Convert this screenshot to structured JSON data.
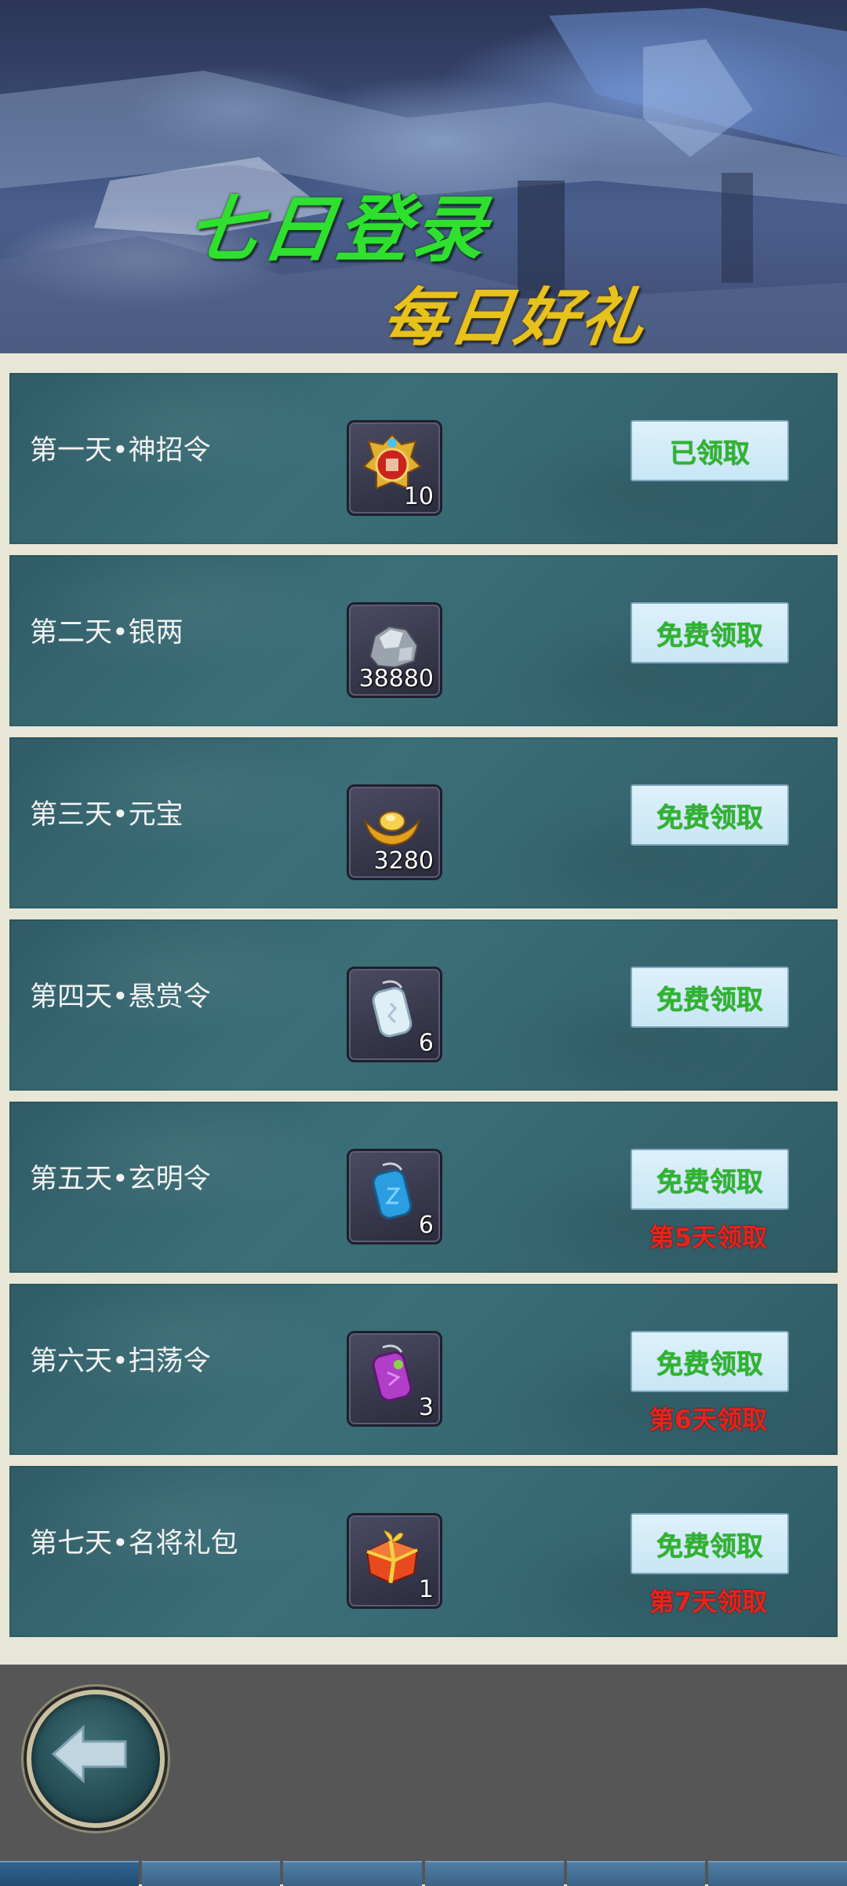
{
  "banner": {
    "title": "七日登录",
    "subtitle": "每日好礼"
  },
  "colors": {
    "title_green": "#2fe02f",
    "subtitle_gold": "#e8c21c",
    "button_text_green": "#2db52d",
    "unlock_red": "#e8231c",
    "row_teal": "#3b6f78"
  },
  "rewards": [
    {
      "label": "第一天•神招令",
      "icon": "summon-token-icon",
      "count": "10",
      "button": "已领取",
      "note": ""
    },
    {
      "label": "第二天•银两",
      "icon": "silver-ore-icon",
      "count": "38880",
      "button": "免费领取",
      "note": ""
    },
    {
      "label": "第三天•元宝",
      "icon": "gold-ingot-icon",
      "count": "3280",
      "button": "免费领取",
      "note": ""
    },
    {
      "label": "第四天•悬赏令",
      "icon": "bounty-token-icon",
      "count": "6",
      "button": "免费领取",
      "note": ""
    },
    {
      "label": "第五天•玄明令",
      "icon": "xuanming-token-icon",
      "count": "6",
      "button": "免费领取",
      "note": "第5天领取"
    },
    {
      "label": "第六天•扫荡令",
      "icon": "sweep-token-icon",
      "count": "3",
      "button": "免费领取",
      "note": "第6天领取"
    },
    {
      "label": "第七天•名将礼包",
      "icon": "general-gift-pack-icon",
      "count": "1",
      "button": "免费领取",
      "note": "第7天领取"
    }
  ],
  "footer": {
    "back_icon": "back-arrow-icon",
    "tabs": [
      "tab-1",
      "tab-2",
      "tab-3",
      "tab-4",
      "tab-5",
      "tab-6"
    ],
    "active_tab": 0
  }
}
